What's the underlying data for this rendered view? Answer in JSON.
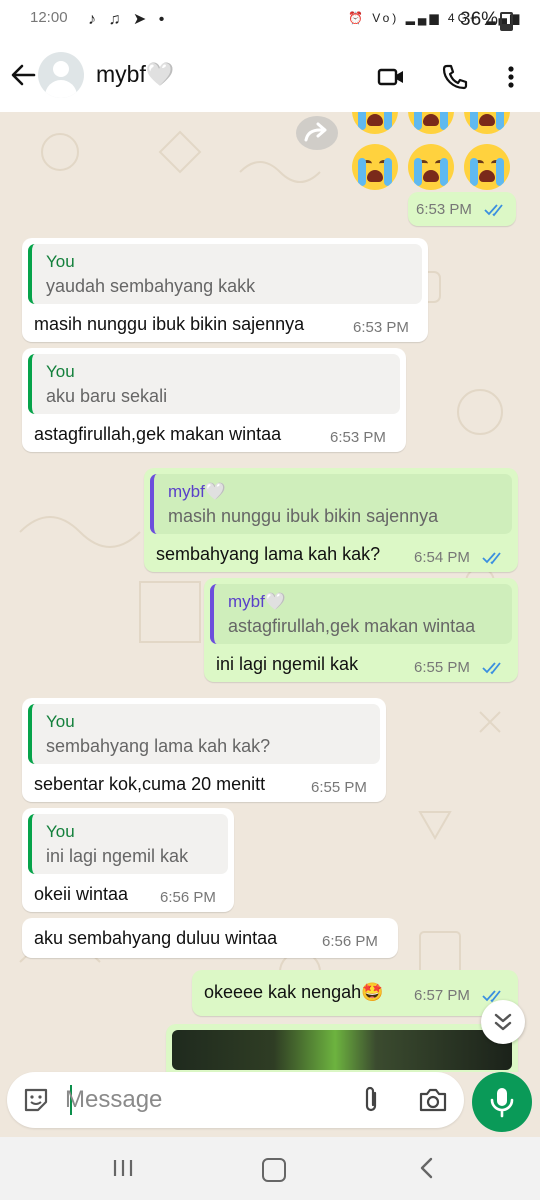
{
  "status_bar": {
    "time": "12:00",
    "left_glyphs": "♪ ♫ ➤ •",
    "right_glyphs": "⏰ Vo) ▂▄▆ 4G+ ▂▄▆",
    "battery": "36%",
    "battery_level": 0.36
  },
  "header": {
    "contact_name": "mybf🤍",
    "icons": [
      "back-arrow-icon",
      "avatar",
      "video-call-icon",
      "voice-call-icon",
      "more-options-icon"
    ]
  },
  "chat": {
    "top_emoji_message": {
      "emoji": "😭😭😭",
      "time": "6:53 PM",
      "status": "read"
    },
    "messages": [
      {
        "dir": "in",
        "quote_name": "You",
        "quote_text": "yaudah sembahyang kakk",
        "text": "masih nunggu ibuk bikin sajennya",
        "time": "6:53 PM"
      },
      {
        "dir": "in",
        "quote_name": "You",
        "quote_text": "aku baru sekali",
        "text": "astagfirullah,gek makan wintaa",
        "time": "6:53 PM"
      },
      {
        "dir": "out",
        "quote_name": "mybf🤍",
        "quote_text": "masih nunggu ibuk bikin sajennya",
        "text": "sembahyang lama kah kak?",
        "time": "6:54 PM",
        "status": "read"
      },
      {
        "dir": "out",
        "quote_name": "mybf🤍",
        "quote_text": "astagfirullah,gek makan wintaa",
        "text": "ini lagi ngemil kak",
        "time": "6:55 PM",
        "status": "read"
      },
      {
        "dir": "in",
        "quote_name": "You",
        "quote_text": "sembahyang lama kah kak?",
        "text": "sebentar kok,cuma 20 menitt",
        "time": "6:55 PM"
      },
      {
        "dir": "in",
        "quote_name": "You",
        "quote_text": "ini lagi ngemil kak",
        "text": "okeii wintaa",
        "time": "6:56 PM"
      },
      {
        "dir": "in",
        "text": "aku sembahyang duluu wintaa",
        "time": "6:56 PM"
      },
      {
        "dir": "out",
        "text": "okeeee kak nengah🤩",
        "time": "6:57 PM",
        "status": "read"
      }
    ]
  },
  "input": {
    "placeholder": "Message",
    "icons": [
      "sticker-icon",
      "attach-icon",
      "camera-icon",
      "mic-icon"
    ]
  },
  "colors": {
    "accent_green": "#0a9a58",
    "outgoing_bubble": "#dcf8c6",
    "incoming_bubble": "#ffffff",
    "chat_background": "#efe7dc",
    "read_ticks": "#3b8fe0",
    "quote_bar_in": "#06a34a",
    "quote_bar_out": "#6c4fdc"
  }
}
